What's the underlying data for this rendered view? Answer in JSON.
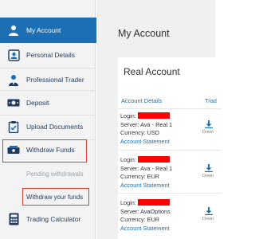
{
  "sidebar": {
    "items": [
      {
        "label": "My Account",
        "icon": "person-icon",
        "active": true
      },
      {
        "label": "Personal Details",
        "icon": "id-card-icon"
      },
      {
        "label": "Professional Trader",
        "icon": "trader-icon"
      },
      {
        "label": "Deposit",
        "icon": "money-icon"
      },
      {
        "label": "Upload Documents",
        "icon": "clipboard-icon"
      },
      {
        "label": "Withdraw Funds",
        "icon": "withdraw-icon"
      },
      {
        "label": "Trading Calculator",
        "icon": "calculator-icon"
      }
    ],
    "sub_items": {
      "pending": "Pending withdrawals",
      "withdraw_yours": "Withdraw your funds"
    }
  },
  "main": {
    "title": "My Account",
    "panel_title": "Real Account",
    "columns": {
      "details": "Account Details",
      "trade": "Trad"
    },
    "accounts": [
      {
        "login_label": "Login:",
        "server": "Server: Ava - Real 1",
        "currency": "Currency: USD",
        "statement": "Account Statement",
        "download": "Down"
      },
      {
        "login_label": "Login:",
        "server": "Server: Ava - Real 1",
        "currency": "Currency: EUR",
        "statement": "Account Statement",
        "download": "Down"
      },
      {
        "login_label": "Login:",
        "server": "Server: AvaOptions",
        "currency": "Currency: EUR",
        "statement": "Account Statement",
        "download": "Down"
      }
    ]
  },
  "colors": {
    "accent": "#1d6fb3",
    "highlight": "#e53935",
    "redaction": "#ff0000"
  }
}
